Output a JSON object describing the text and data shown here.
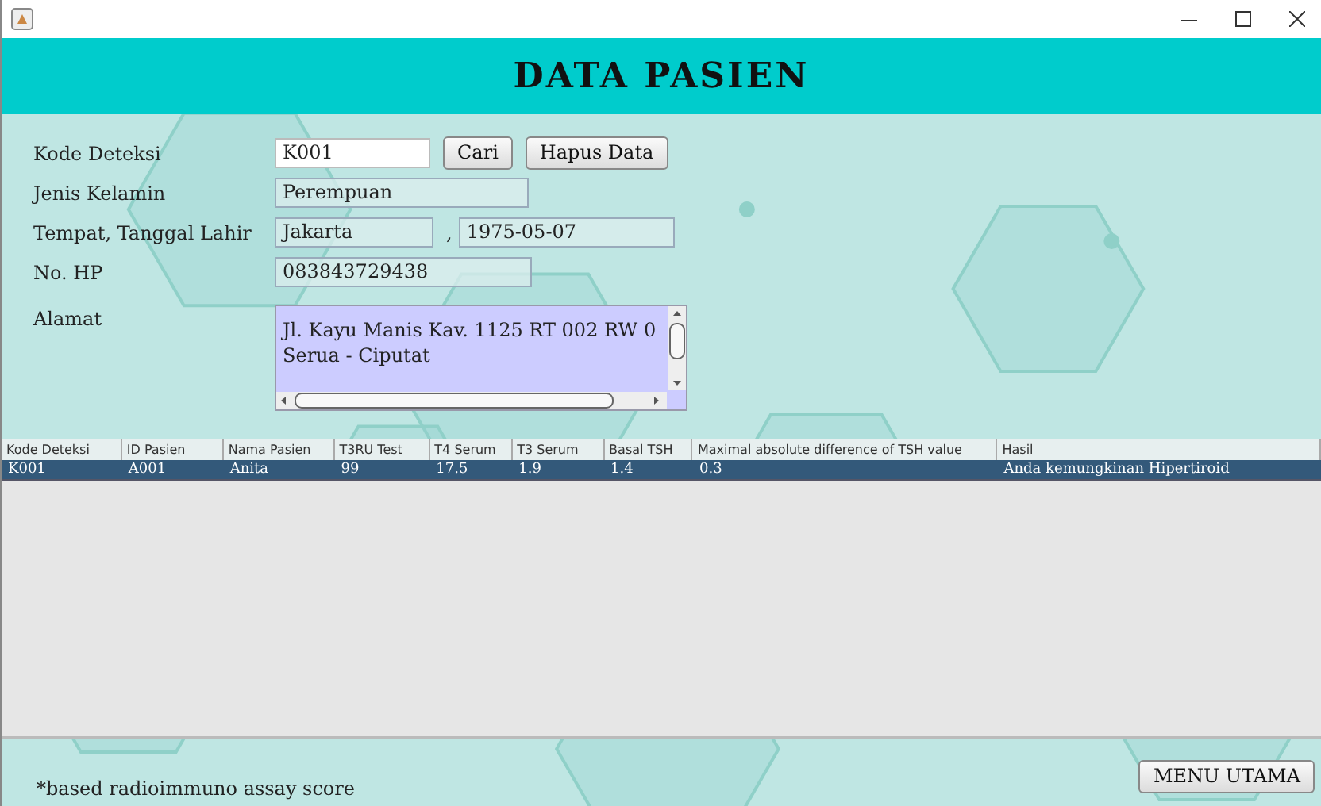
{
  "header": {
    "title": "DATA PASIEN"
  },
  "form": {
    "kode_deteksi": {
      "label": "Kode Deteksi",
      "value": "K001"
    },
    "buttons": [
      "Cari",
      "Hapus Data"
    ],
    "jenis_kelamin": {
      "label": "Jenis Kelamin",
      "value": "Perempuan"
    },
    "tempat_tanggal_lahir": {
      "label": "Tempat, Tanggal Lahir",
      "place": "Jakarta",
      "separator": ",",
      "date": "1975-05-07"
    },
    "no_hp": {
      "label": "No. HP",
      "value": "083843729438"
    },
    "alamat": {
      "label": "Alamat",
      "value": "Jl. Kayu Manis Kav. 1125 RT 002 RW 0\nSerua - Ciputat"
    }
  },
  "table": {
    "columns": [
      "Kode Deteksi",
      "ID Pasien",
      "Nama Pasien",
      "T3RU Test",
      "T4 Serum",
      "T3 Serum",
      "Basal TSH",
      "Maximal absolute difference of TSH value",
      "Hasil"
    ],
    "rows": [
      {
        "selected": true,
        "cells": [
          "K001",
          "A001",
          "Anita",
          "99",
          "17.5",
          "1.9",
          "1.4",
          "0.3",
          "Anda kemungkinan Hipertiroid"
        ]
      }
    ]
  },
  "footer": {
    "note": "*based radioimmuno assay score",
    "button": "MENU UTAMA"
  }
}
